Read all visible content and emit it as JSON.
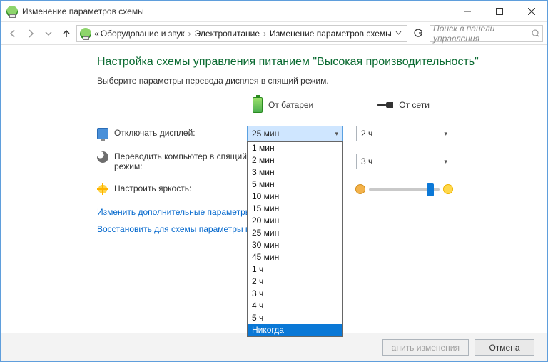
{
  "titlebar": {
    "title": "Изменение параметров схемы"
  },
  "breadcrumb": {
    "prefix": "«",
    "items": [
      "Оборудование и звук",
      "Электропитание",
      "Изменение параметров схемы"
    ]
  },
  "search": {
    "placeholder": "Поиск в панели управления"
  },
  "page": {
    "heading": "Настройка схемы управления питанием \"Высокая производительность\"",
    "subtitle": "Выберите параметры перевода дисплея в спящий режим."
  },
  "columns": {
    "battery": "От батареи",
    "plugged": "От сети"
  },
  "rows": {
    "display_off": {
      "label": "Отключать дисплей:",
      "battery": "25 мин",
      "plugged": "2 ч"
    },
    "sleep": {
      "label": "Переводить компьютер в спящий режим:",
      "plugged": "3 ч"
    },
    "brightness": {
      "label": "Настроить яркость:",
      "thumb_pct": 82
    }
  },
  "dropdown_options": [
    "1 мин",
    "2 мин",
    "3 мин",
    "5 мин",
    "10 мин",
    "15 мин",
    "20 мин",
    "25 мин",
    "30 мин",
    "45 мин",
    "1 ч",
    "2 ч",
    "3 ч",
    "4 ч",
    "5 ч",
    "Никогда"
  ],
  "dropdown_selected": "Никогда",
  "links": {
    "advanced": "Изменить дополнительные параметры пи",
    "restore": "Восстановить для схемы параметры по ум"
  },
  "buttons": {
    "save": "анить изменения",
    "cancel": "Отмена"
  }
}
